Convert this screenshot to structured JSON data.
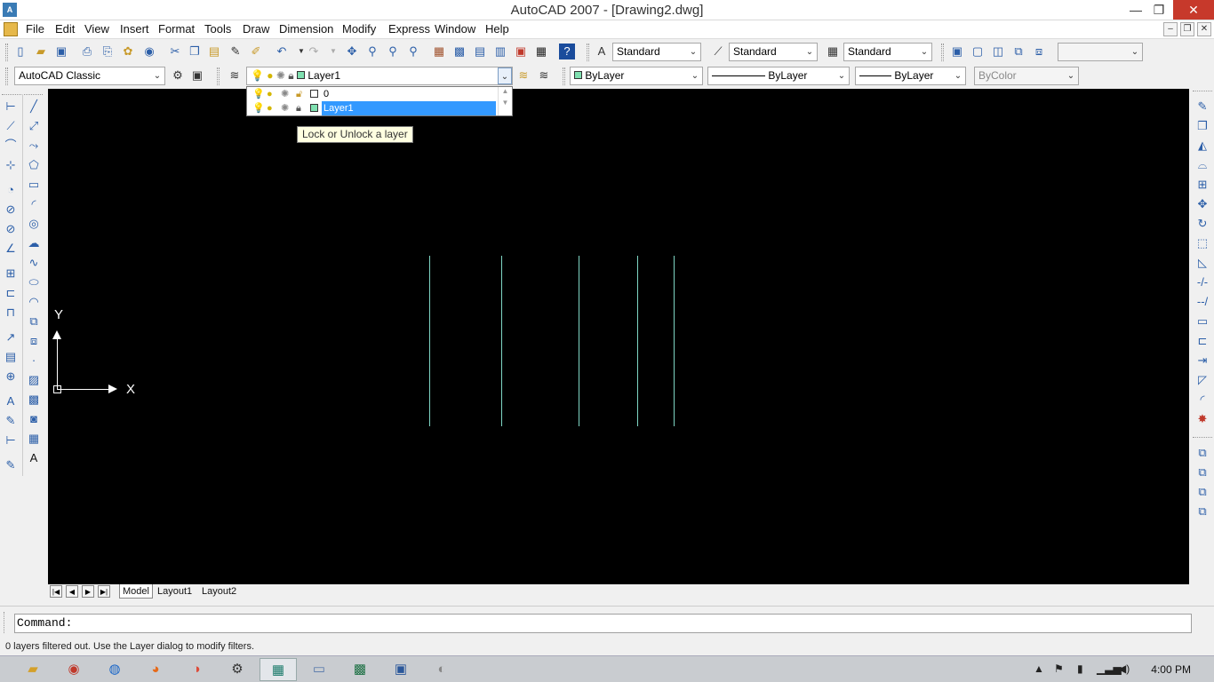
{
  "window": {
    "title": "AutoCAD 2007 - [Drawing2.dwg]",
    "logo": "A",
    "min": "—",
    "max": "❐",
    "close": "✕"
  },
  "menu": {
    "items": [
      "File",
      "Edit",
      "View",
      "Insert",
      "Format",
      "Tools",
      "Draw",
      "Dimension",
      "Modify",
      "Express",
      "Window",
      "Help"
    ],
    "doc_min": "–",
    "doc_restore": "❐",
    "doc_close": "✕"
  },
  "styles_toolbar": {
    "text_style": "Standard",
    "dim_style": "Standard",
    "table_style": "Standard"
  },
  "workspace": {
    "current": "AutoCAD Classic"
  },
  "layers": {
    "current": "Layer1",
    "dropdown": [
      {
        "name": "0",
        "selected": false
      },
      {
        "name": "Layer1",
        "selected": true
      }
    ],
    "tooltip": "Lock or Unlock a layer"
  },
  "properties": {
    "color": "ByLayer",
    "linetype": "ByLayer",
    "lineweight": "ByLayer",
    "plotstyle": "ByColor"
  },
  "ucs": {
    "x": "X",
    "y": "Y"
  },
  "tabs": {
    "items": [
      "Model",
      "Layout1",
      "Layout2"
    ],
    "active": "Model"
  },
  "command": {
    "prompt": "Command:"
  },
  "status": {
    "message": "0 layers filtered out.  Use the Layer dialog to modify filters."
  },
  "taskbar": {
    "clock": "4:00 PM"
  },
  "colors": {
    "canvas": "#000000",
    "line": "#7fd6c4",
    "selection": "#3399ff",
    "close_button": "#c7392b"
  }
}
